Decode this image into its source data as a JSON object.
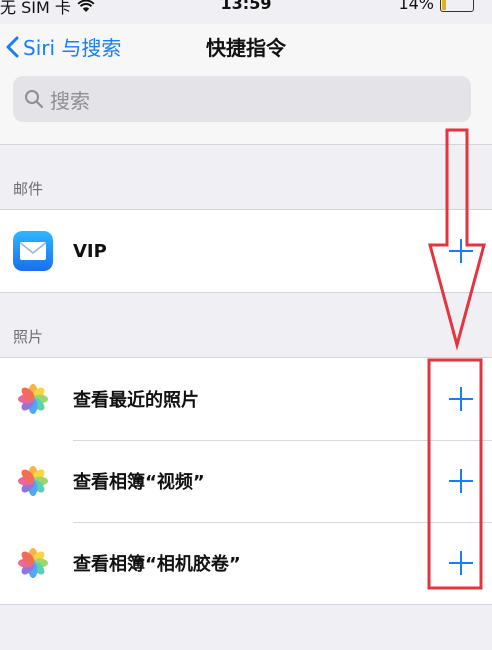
{
  "status_bar": {
    "carrier": "无 SIM 卡",
    "time": "13:59",
    "battery": "14%",
    "battery_level": 0.14
  },
  "nav": {
    "back_label": "Siri 与搜索",
    "title": "快捷指令"
  },
  "search": {
    "placeholder": "搜索"
  },
  "sections": [
    {
      "header": "邮件",
      "items": [
        {
          "label": "VIP",
          "icon": "mail-icon"
        }
      ]
    },
    {
      "header": "照片",
      "items": [
        {
          "label": "查看最近的照片",
          "icon": "photos-icon"
        },
        {
          "label": "查看相簿“视频”",
          "icon": "photos-icon"
        },
        {
          "label": "查看相簿“相机胶卷”",
          "icon": "photos-icon"
        }
      ]
    }
  ],
  "colors": {
    "accent": "#157efb",
    "annotation": "#e53340",
    "background": "#efeff4"
  }
}
